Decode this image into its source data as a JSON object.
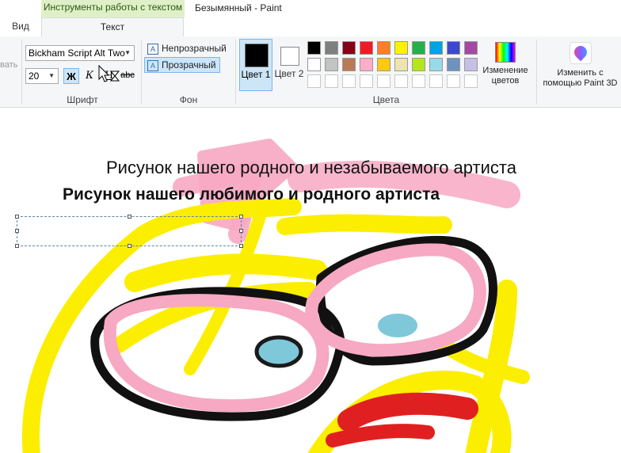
{
  "title_bar": {
    "context_tab": "Инструменты работы с текстом",
    "window_title": "Безымянный - Paint"
  },
  "tabs": {
    "view": "Вид",
    "text": "Текст"
  },
  "ribbon": {
    "cut_partial": "вать",
    "font": {
      "family_value": "Bickham Script Alt Two",
      "size_value": "20",
      "bold_glyph": "Ж",
      "italic_glyph": "К",
      "underline_glyph": "Ч",
      "strike_glyph": "abc",
      "group_label": "Шрифт"
    },
    "background": {
      "opaque_label": "Непрозрачный",
      "transparent_label": "Прозрачный",
      "group_label": "Фон",
      "icon_glyph": "A"
    },
    "colors": {
      "color1_label": "Цвет 1",
      "color2_label": "Цвет 2",
      "group_label": "Цвета",
      "color1": "#000000",
      "color2": "#ffffff",
      "palette_row1": [
        "#000000",
        "#7f7f7f",
        "#880015",
        "#ed1c24",
        "#ff7f27",
        "#fff200",
        "#22b14c",
        "#00a2e8",
        "#3f48cc",
        "#a349a4"
      ],
      "palette_row2": [
        "#ffffff",
        "#c3c3c3",
        "#b97a57",
        "#ffaec9",
        "#ffc90e",
        "#efe4b0",
        "#b5e61d",
        "#99d9ea",
        "#7092be",
        "#c8bfe7"
      ],
      "palette_row3": [
        "#ffffff",
        "#ffffff",
        "#ffffff",
        "#ffffff",
        "#ffffff",
        "#ffffff",
        "#ffffff",
        "#ffffff",
        "#ffffff",
        "#ffffff"
      ],
      "edit_colors_label": "Изменение цветов"
    },
    "paint3d_label": "Изменить с помощью Paint 3D"
  },
  "canvas": {
    "text_line1": "Рисунок нашего родного и незабываемого артиста",
    "text_line2": "Рисунок нашего любимого и родного артиста"
  }
}
